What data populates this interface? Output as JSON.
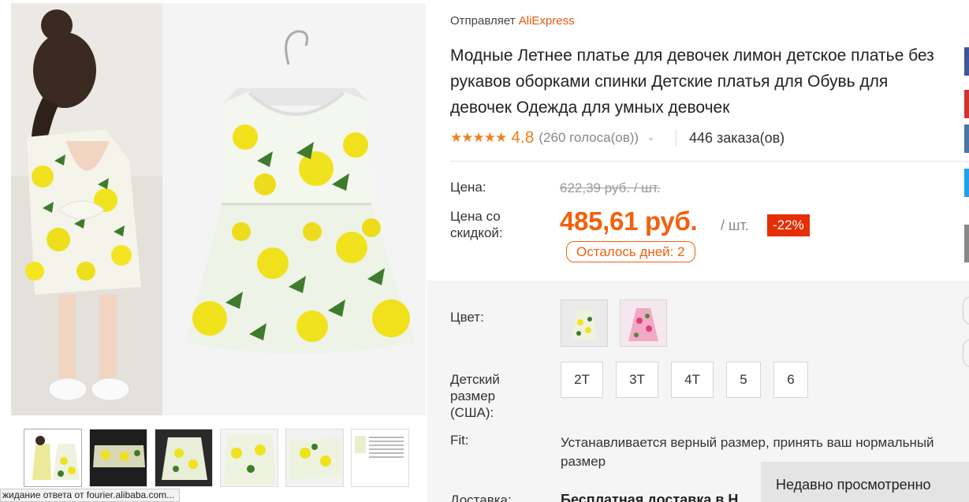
{
  "seller": {
    "prefix": "Отправляет ",
    "brand": "AliExpress"
  },
  "product": {
    "title": "Модные Летнее платье для девочек лимон детское платье без рукавов оборками спинки Детские платья для Обувь для девочек Одежда для умных девочек",
    "stars": "★★★★★",
    "rating": "4.8",
    "votes": "(260 голоса(ов))",
    "orders": "446 заказа(ов)"
  },
  "price": {
    "label": "Цена:",
    "old": "622,39 руб. / шт.",
    "discount_label": "Цена со скидкой:",
    "new": "485,61 руб.",
    "per_unit": "/ шт.",
    "badge": "-22%",
    "days_left": "Осталось дней: 2"
  },
  "options": {
    "color_label": "Цвет:",
    "colors": [
      {
        "name": "yellow-lemon",
        "hex": "#f3e21c",
        "selected": true
      },
      {
        "name": "pink",
        "hex": "#e8629a",
        "selected": false
      }
    ],
    "size_label": "Детский размер (США):",
    "sizes": [
      "2T",
      "3T",
      "4T",
      "5",
      "6"
    ],
    "fit_label": "Fit:",
    "fit_text": "Устанавливается верный размер, принять ваш нормальный размер",
    "shipping_label": "Доставка:",
    "shipping_text": "Бесплатная доставка в Н"
  },
  "recently_viewed": "Недавно просмотренно",
  "status_bar": "жидание ответа от fourier.alibaba.com...",
  "colors": {
    "accent": "#f3600c",
    "badge": "#e62e04",
    "star": "#f0801e"
  }
}
